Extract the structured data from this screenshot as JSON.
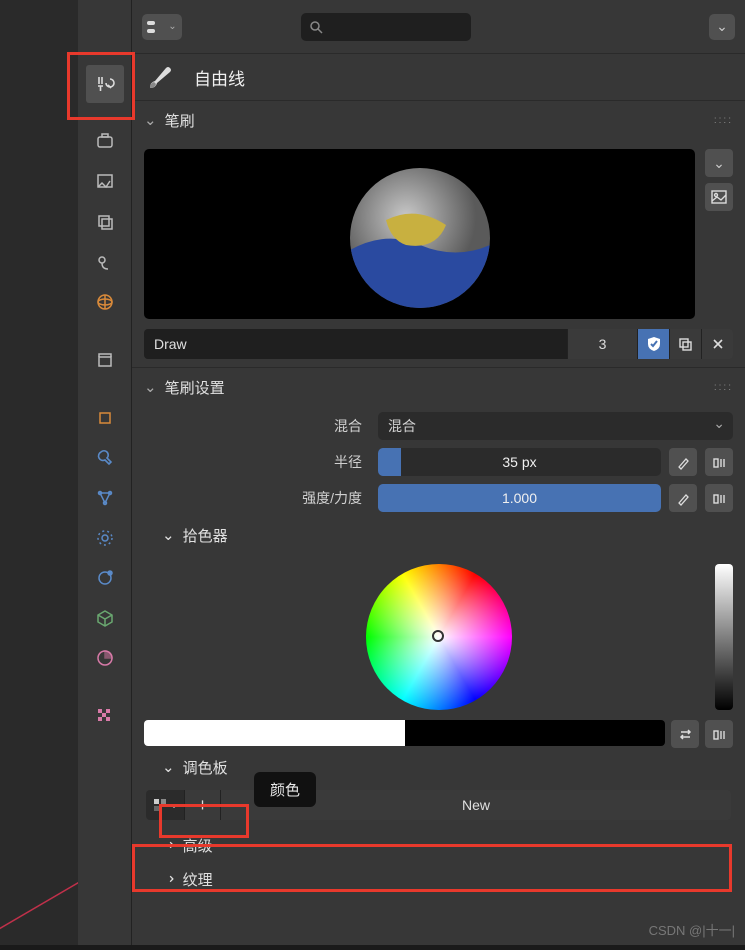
{
  "header": {
    "tool_label": "自由线"
  },
  "sections": {
    "brush": {
      "title": "笔刷",
      "name_value": "Draw",
      "user_count": "3"
    },
    "brush_settings": {
      "title": "笔刷设置",
      "blend_label": "混合",
      "blend_value": "混合",
      "radius_label": "半径",
      "radius_value": "35 px",
      "strength_label": "强度/力度",
      "strength_value": "1.000"
    },
    "color_picker": {
      "title": "拾色器",
      "tooltip": "颜色"
    },
    "palette": {
      "title": "调色板",
      "new_label": "New"
    },
    "advanced": {
      "title": "高级"
    },
    "texture": {
      "title": "纹理"
    }
  },
  "watermark": "CSDN @|十一|"
}
